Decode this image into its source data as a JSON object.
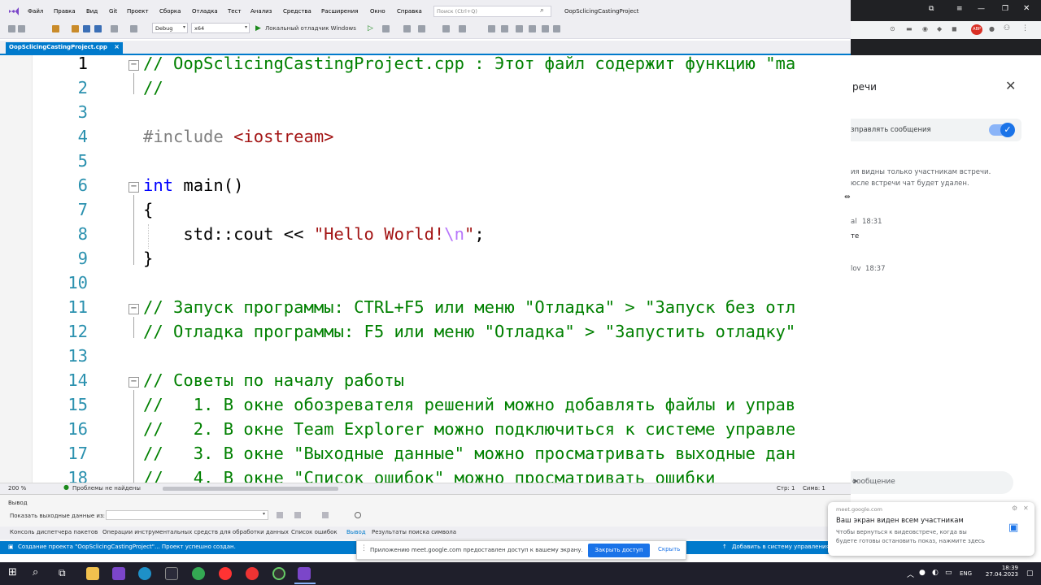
{
  "menu": {
    "items": [
      "Файл",
      "Правка",
      "Вид",
      "Git",
      "Проект",
      "Сборка",
      "Отладка",
      "Тест",
      "Анализ",
      "Средства",
      "Расширения",
      "Окно",
      "Справка"
    ],
    "search_placeholder": "Поиск (Ctrl+Q)",
    "project_title": "OopSclicingCastingProject"
  },
  "toolbar": {
    "config": "Debug",
    "platform": "x64",
    "run_label": "Локальный отладчик Windows"
  },
  "tab": {
    "file": "OopSclicingCastingProject.cpp",
    "close": "×"
  },
  "code": {
    "l1": "// OopSclicingCastingProject.cpp : Этот файл содержит функцию \"ma",
    "l2": "//",
    "l4_pp": "#include ",
    "l4_str": "<iostream>",
    "l6_kw": "int",
    "l6_rest": " main()",
    "l7": "{",
    "l8_a": "    std::cout << ",
    "l8_str": "\"Hello World!",
    "l8_esc": "\\n",
    "l8_str2": "\"",
    "l8_end": ";",
    "l9": "}",
    "l11": "// Запуск программы: CTRL+F5 или меню \"Отладка\" > \"Запуск без отл",
    "l12": "// Отладка программы: F5 или меню \"Отладка\" > \"Запустить отладку\"",
    "l14": "// Советы по началу работы",
    "l15": "//   1. В окне обозревателя решений можно добавлять файлы и управ",
    "l16": "//   2. В окне Team Explorer можно подключиться к системе управле",
    "l17": "//   3. В окне \"Выходные данные\" можно просматривать выходные дан",
    "l18": "//   4. В окне \"Список ошибок\" можно просматривать ошибки"
  },
  "line_numbers": [
    "1",
    "2",
    "3",
    "4",
    "5",
    "6",
    "7",
    "8",
    "9",
    "10",
    "11",
    "12",
    "13",
    "14",
    "15",
    "16",
    "17",
    "18"
  ],
  "editor_status": {
    "zoom": "200 %",
    "problems": "Проблемы не найдены",
    "line": "Стр: 1",
    "col": "Симв: 1"
  },
  "output": {
    "title": "Вывод",
    "show_from": "Показать выходные данные из:",
    "tabs": [
      "Консоль диспетчера пакетов",
      "Операции инструментальных средств для обработки данных",
      "Список ошибок",
      "Вывод",
      "Результаты поиска символа"
    ]
  },
  "statusbar": {
    "message": "Создание проекта \"OopSclicingCastingProject\"... Проект успешно создан.",
    "source_control": "Добавить в систему управления"
  },
  "meet": {
    "chat_title": "речи",
    "allow_messages": "зправлять сообщения",
    "note1": "ия видны только участникам встречи.",
    "note2": "юсле встречи чат будет удален.",
    "msg1_author": "al",
    "msg1_time": "18:31",
    "msg1_text": "те",
    "msg2_author": "lov",
    "msg2_time": "18:37",
    "input_placeholder": "сообщение"
  },
  "toast": {
    "source": "meet.google.com",
    "title": "Ваш экран виден всем участникам",
    "body1": "Чтобы вернуться к видеовстрече, когда вы",
    "body2": "будете готовы остановить показ, нажмите здесь"
  },
  "sharebar": {
    "text": "Приложению meet.google.com предоставлен доступ к вашему экрану.",
    "stop": "Закрыть доступ",
    "hide": "Скрыть"
  },
  "tray": {
    "lang": "ENG",
    "time": "18:39",
    "date": "27.04.2023"
  },
  "colors": {
    "accent": "#007acc",
    "comment": "#008000",
    "keyword": "#0000ff",
    "string": "#a31515"
  }
}
